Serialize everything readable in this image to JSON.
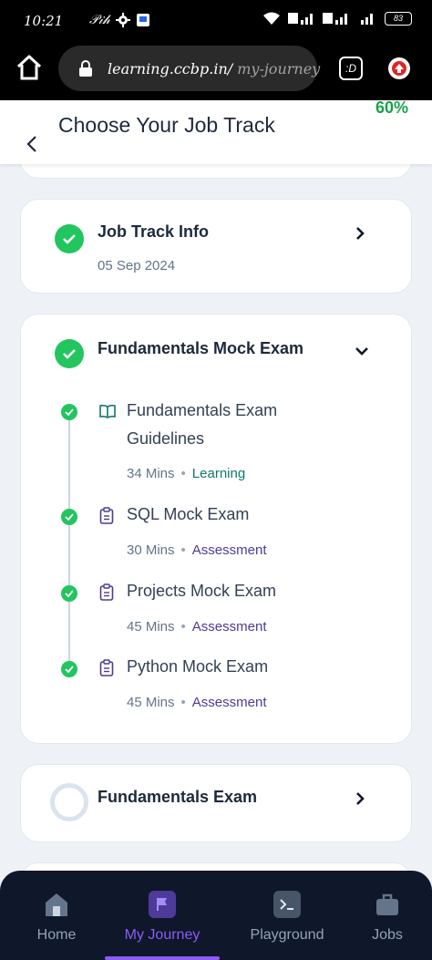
{
  "status_bar": {
    "time": "10:21",
    "carrier_glyph": "𝒫𝒾𝒽",
    "battery": "83"
  },
  "browser": {
    "url_host": "learning.ccbp.in/",
    "url_path": " my-journey",
    "tab_glyph": ":D"
  },
  "header": {
    "title": "Choose Your Job Track",
    "progress": "60%"
  },
  "job_track_info": {
    "title": "Job Track Info",
    "date": "05 Sep 2024"
  },
  "mock_exam": {
    "title": "Fundamentals Mock Exam",
    "items": [
      {
        "title_line1": "Fundamentals Exam",
        "title_line2": "Guidelines",
        "duration": "34 Mins",
        "type": "Learning"
      },
      {
        "title_line1": "SQL Mock Exam",
        "duration": "30 Mins",
        "type": "Assessment"
      },
      {
        "title_line1": "Projects Mock Exam",
        "duration": "45 Mins",
        "type": "Assessment"
      },
      {
        "title_line1": "Python Mock Exam",
        "duration": "45 Mins",
        "type": "Assessment"
      }
    ]
  },
  "fundamentals_exam": {
    "title": "Fundamentals Exam"
  },
  "nav": {
    "items": [
      {
        "label": "Home",
        "icon": "home-icon"
      },
      {
        "label": "My Journey",
        "icon": "flag-icon"
      },
      {
        "label": "Playground",
        "icon": "terminal-icon"
      },
      {
        "label": "Jobs",
        "icon": "briefcase-icon"
      }
    ],
    "active": "My Journey"
  },
  "colors": {
    "accent": "#8b5cf6",
    "success": "#22c55e",
    "nav_bg": "#0f172a"
  }
}
